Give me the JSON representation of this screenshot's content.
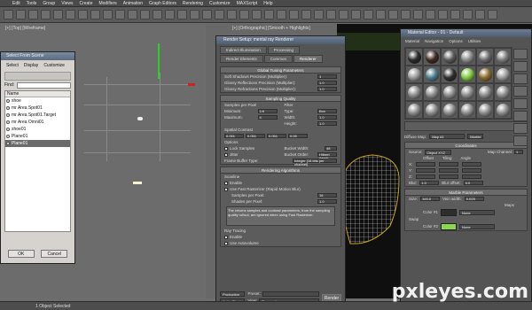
{
  "menubar": [
    "Edit",
    "Tools",
    "Group",
    "Views",
    "Create",
    "Modifiers",
    "Animation",
    "Graph Editors",
    "Rendering",
    "Customize",
    "MAXScript",
    "Help"
  ],
  "viewports": {
    "left_label": "[+] [Top] [Wireframe]",
    "mid_label": "[+] [Orthographic] [Smooth + Highlights]"
  },
  "select_window": {
    "title": "Select From Scene",
    "menu": [
      "Select",
      "Display",
      "Customize"
    ],
    "find_label": "Find:",
    "column_header": "Name",
    "items": [
      "shoe",
      "mr Area Spot01",
      "mr Area Spot01.Target",
      "mr Area Omni01",
      "shoe01",
      "Plane01",
      "Plane01"
    ],
    "selected_index": 6,
    "ok": "OK",
    "cancel": "Cancel"
  },
  "render_window": {
    "title": "Render Setup: mental ray Renderer",
    "tabs": [
      "Indirect Illumination",
      "Processing",
      "Render Elements",
      "Common",
      "Renderer"
    ],
    "active_tab": "Renderer",
    "global": {
      "head": "Global Tuning Parameters",
      "rows": [
        {
          "label": "Soft Shadows Precision (Multiplier):",
          "value": "1"
        },
        {
          "label": "Glossy Reflections Precision (Multiplier):",
          "value": "1.0"
        },
        {
          "label": "Glossy Refractions Precision (Multiplier):",
          "value": "1.0"
        }
      ]
    },
    "sampling": {
      "head": "Sampling Quality",
      "samples_label": "Samples per Pixel",
      "filter_label": "Filter",
      "rows": [
        {
          "label": "Minimum:",
          "value": "1/4",
          "flabel": "Type:",
          "fvalue": "Box"
        },
        {
          "label": "Maximum:",
          "value": "4",
          "flabel": "Width:",
          "fvalue": "1.0"
        },
        {
          "label": "",
          "value": "",
          "flabel": "Height:",
          "fvalue": "1.0"
        }
      ],
      "contrast_label": "Spatial Contrast",
      "contrast_values": [
        "0.051",
        "0.051",
        "0.051",
        "0.05"
      ],
      "options_label": "Options",
      "lock_samples": "Lock Samples",
      "jitter": "Jitter",
      "bucket_width_label": "Bucket Width:",
      "bucket_width": "48",
      "bucket_order_label": "Bucket Order:",
      "bucket_order": "Hilbert (best)",
      "frame_buffer_label": "Frame Buffer Type:",
      "frame_buffer": "Integer (16 bits per channel)"
    },
    "algorithms": {
      "head": "Rendering Algorithms",
      "scanline": "Scanline",
      "enable": "Enable",
      "fast_raster": "Use Fast Rasterizer (Rapid Motion Blur)",
      "samples_per_pixel_label": "Samples per Pixel:",
      "samples_per_pixel": "16",
      "shades_label": "Shades per Pixel:",
      "shades": "1.0",
      "note": "The returns samples and contrast parameters, from the sampling quality rollout, are ignored when using Fast Rasterizer.",
      "ray_tracing": "Ray Tracing",
      "ray_enable": "Enable",
      "autovolume": "Use Autovolume"
    },
    "bottom": {
      "mode": "Production",
      "preset_label": "Preset:",
      "activeshade": "ActiveShade",
      "view_label": "View:",
      "view": "Perspective",
      "render": "Render"
    }
  },
  "material_window": {
    "title": "Material Editor - 01 - Default",
    "menu": [
      "Material",
      "Navigation",
      "Options",
      "Utilities"
    ],
    "spheres": [
      "#2a2a2a",
      "#3c2a22",
      "#5a5a5a",
      "#8a8a8a",
      "#6a6a6a",
      "#7a7a7a",
      "#9a9a9a",
      "#4a7a8a",
      "#2e2e2e",
      "#7ec840",
      "#8a6a2a",
      "#9a9a9a",
      "#8a8a8a",
      "#8a8a8a",
      "#8a8a8a",
      "#8a8a8a",
      "#8a8a8a",
      "#8a8a8a",
      "#8a8a8a",
      "#8a8a8a",
      "#8a8a8a",
      "#8a8a8a",
      "#8a8a8a",
      "#8a8a8a"
    ],
    "diffuse_label": "Diffuse Map:",
    "map_name": "Map #1",
    "type_label": "Marble",
    "coordinates": {
      "head": "Coordinates",
      "source_label": "Source:",
      "source": "Object XYZ",
      "map_channel_label": "Map Channel:",
      "map_channel": "1",
      "cols": [
        "Offset",
        "Tiling",
        "Angle"
      ],
      "axes": [
        "X:",
        "Y:",
        "Z:"
      ],
      "blur_label": "Blur:",
      "blur": "1.0",
      "blur_offset_label": "Blur offset:",
      "blur_offset": "0.0"
    },
    "marble": {
      "head": "Marble Parameters",
      "size_label": "Size:",
      "size": "100.0",
      "vein_label": "Vein width:",
      "vein": "0.025",
      "maps_label": "Maps",
      "swap": "Swap",
      "color1_label": "Color #1",
      "color2_label": "Color #2",
      "color1": "#2e2e2e",
      "color2": "#8ad84e",
      "none": "None"
    }
  },
  "status": "1 Object Selected",
  "watermark": "pxleyes.com"
}
